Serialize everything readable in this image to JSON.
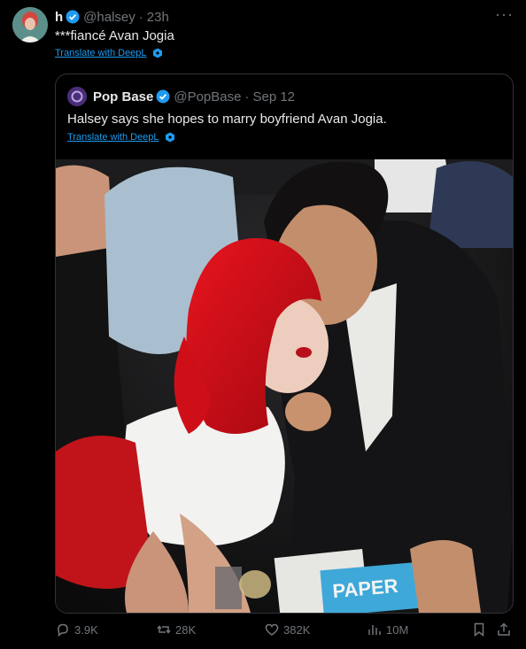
{
  "tweet": {
    "author_name": "h",
    "handle": "@halsey",
    "separator": "·",
    "time": "23h",
    "text": "***fiancé Avan Jogia",
    "translate_label": "Translate with DeepL",
    "more_label": "···"
  },
  "quote": {
    "author_name": "Pop Base",
    "handle": "@PopBase",
    "separator": "·",
    "date": "Sep 12",
    "text": "Halsey says she hopes to marry boyfriend Avan Jogia.",
    "translate_label": "Translate with DeepL",
    "magazine_title": "PAPER"
  },
  "actions": {
    "replies": "3.9K",
    "reposts": "28K",
    "likes": "382K",
    "views": "10M"
  },
  "colors": {
    "background": "#000000",
    "text": "#e7e9ea",
    "muted": "#71767b",
    "link": "#1d9bf0",
    "border": "#2f3336"
  }
}
